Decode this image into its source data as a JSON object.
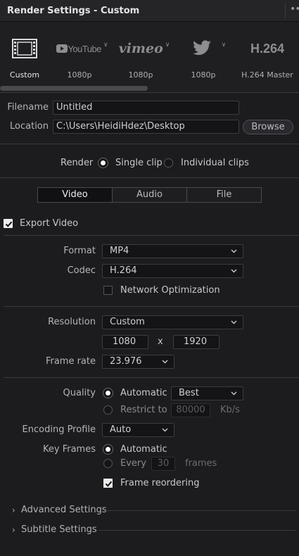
{
  "window": {
    "title": "Render Settings - Custom",
    "menu_glyph": "••"
  },
  "presets": [
    {
      "id": "custom",
      "label": "Custom",
      "icon": "film-icon",
      "selected": true
    },
    {
      "id": "youtube",
      "label": "1080p",
      "logo_text": "YouTube",
      "icon": "youtube-logo"
    },
    {
      "id": "vimeo",
      "label": "1080p",
      "logo_text": "vimeo",
      "icon": "vimeo-logo"
    },
    {
      "id": "twitter",
      "label": "1080p",
      "icon": "twitter-bird-icon"
    },
    {
      "id": "h264",
      "label": "H.264 Master",
      "logo_text": "H.264",
      "icon": "h264-logo"
    }
  ],
  "file": {
    "filename_label": "Filename",
    "filename_value": "Untitled",
    "location_label": "Location",
    "location_value": "C:\\Users\\HeidiHdez\\Desktop",
    "browse_label": "Browse"
  },
  "render": {
    "label": "Render",
    "single_clip": "Single clip",
    "individual_clips": "Individual clips",
    "selected": "single_clip"
  },
  "tabs": [
    {
      "label": "Video",
      "active": true
    },
    {
      "label": "Audio",
      "active": false
    },
    {
      "label": "File",
      "active": false
    }
  ],
  "export_video": {
    "label": "Export Video",
    "checked": true
  },
  "format": {
    "label": "Format",
    "value": "MP4"
  },
  "codec": {
    "label": "Codec",
    "value": "H.264"
  },
  "network_opt": {
    "label": "Network Optimization",
    "checked": false
  },
  "resolution": {
    "label": "Resolution",
    "value": "Custom",
    "width": "1080",
    "times": "x",
    "height": "1920"
  },
  "frame_rate": {
    "label": "Frame rate",
    "value": "23.976"
  },
  "quality": {
    "label": "Quality",
    "automatic_label": "Automatic",
    "automatic_value": "Best",
    "restrict_label": "Restrict to",
    "restrict_value": "80000",
    "restrict_unit": "Kb/s",
    "selected": "automatic"
  },
  "encoding_profile": {
    "label": "Encoding Profile",
    "value": "Auto"
  },
  "key_frames": {
    "label": "Key Frames",
    "automatic_label": "Automatic",
    "every_label": "Every",
    "every_value": "30",
    "every_unit": "frames",
    "selected": "automatic"
  },
  "frame_reordering": {
    "label": "Frame reordering",
    "checked": true
  },
  "sections": [
    {
      "label": "Advanced Settings"
    },
    {
      "label": "Subtitle Settings"
    }
  ],
  "colors": {
    "background": "#1c1c1e",
    "field_bg": "#141416",
    "accent_radio": "#ffffff"
  }
}
